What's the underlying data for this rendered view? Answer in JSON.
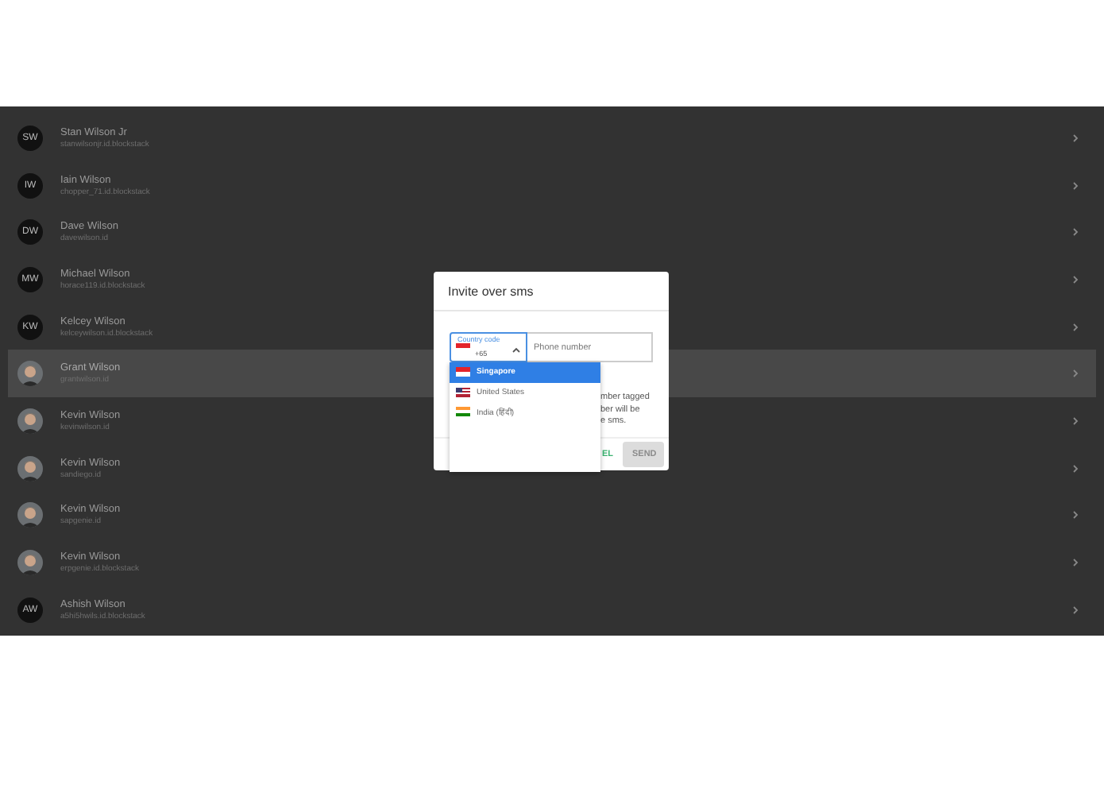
{
  "contacts": [
    {
      "name": "Stan Wilson Jr",
      "id": "stanwilsonjr.id.blockstack",
      "kind": "initials",
      "initials": "SW",
      "selected": false
    },
    {
      "name": "Iain Wilson",
      "id": "chopper_71.id.blockstack",
      "kind": "initials",
      "initials": "IW",
      "selected": false
    },
    {
      "name": "Dave Wilson",
      "id": "davewilson.id",
      "kind": "initials",
      "initials": "DW",
      "selected": false
    },
    {
      "name": "Michael Wilson",
      "id": "horace119.id.blockstack",
      "kind": "initials",
      "initials": "MW",
      "selected": false
    },
    {
      "name": "Kelcey Wilson",
      "id": "kelceywilson.id.blockstack",
      "kind": "initials",
      "initials": "KW",
      "selected": false
    },
    {
      "name": "Grant Wilson",
      "id": "grantwilson.id",
      "selected": true
    },
    {
      "name": "Kevin Wilson",
      "id": "kevinwilson.id",
      "selected": false
    },
    {
      "name": "Kevin Wilson",
      "id": "sandiego.id",
      "selected": false
    },
    {
      "name": "Kevin Wilson",
      "id": "sapgenie.id",
      "selected": false
    },
    {
      "name": "Kevin Wilson",
      "id": "erpgenie.id.blockstack",
      "selected": false
    },
    {
      "name": "Ashish Wilson",
      "id": "a5hi5hwils.id.blockstack",
      "kind": "initials",
      "initials": "AW",
      "selected": false
    }
  ],
  "dialog": {
    "title": "Invite over sms",
    "country_code": {
      "label": "Country code",
      "value": "+65",
      "expanded": true
    },
    "phone": {
      "placeholder": "Phone number"
    },
    "options": [
      {
        "label": "Singapore",
        "kind": "sg",
        "selected": true
      },
      {
        "label": "United States",
        "kind": "us",
        "selected": false
      },
      {
        "label": "India (हिंदी)",
        "kind": "in",
        "selected": false
      }
    ],
    "hint_lines": [
      "mber tagged",
      "ber will be",
      "e sms."
    ],
    "cancel": "EL",
    "send": {
      "label": "SEND",
      "disabled": true
    }
  }
}
